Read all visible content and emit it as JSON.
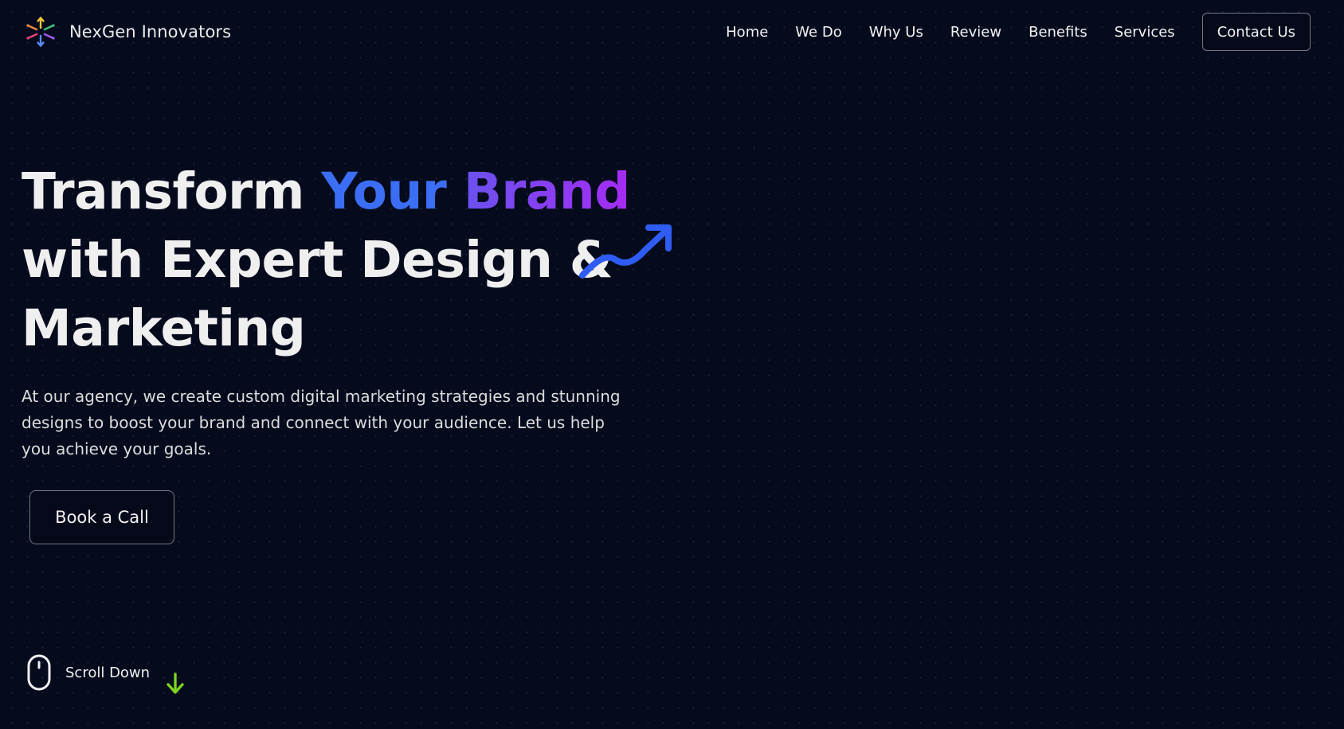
{
  "brand": {
    "name": "NexGen Innovators",
    "logo_icon": "sparkle-arrows-icon"
  },
  "nav": {
    "links": [
      "Home",
      "We Do",
      "Why Us",
      "Review",
      "Benefits",
      "Services"
    ],
    "contact_label": "Contact Us"
  },
  "hero": {
    "title_part1": "Transform ",
    "title_your": "Your",
    "title_space": " ",
    "title_brand": "Brand",
    "title_line2": "with Expert Design &",
    "title_line3": "Marketing",
    "description": "At our agency, we create custom digital marketing strategies and stunning designs to boost your brand and connect with your audience. Let us help you achieve your goals.",
    "cta_label": "Book a Call",
    "trend_icon": "trending-up-icon"
  },
  "scroll": {
    "label": "Scroll Down",
    "icon": "mouse-icon",
    "arrow_icon": "arrow-down-icon"
  },
  "colors": {
    "background": "#050b1d",
    "accent_blue": "#3b6ef5",
    "accent_purple": "#a52bf2",
    "scroll_arrow": "#7cd321"
  }
}
